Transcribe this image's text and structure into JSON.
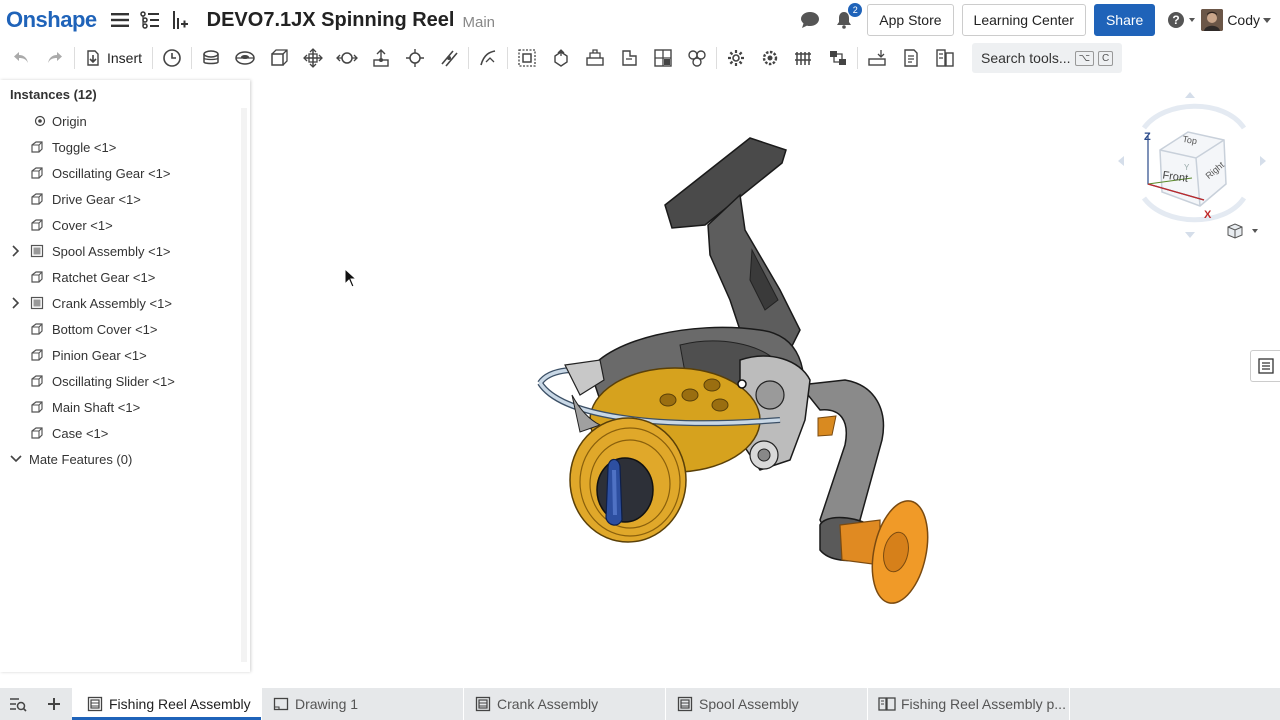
{
  "header": {
    "logo": "Onshape",
    "doc_title": "DEVO7.1JX Spinning Reel",
    "branch": "Main",
    "notification_count": "2",
    "app_store": "App Store",
    "learning_center": "Learning Center",
    "share": "Share",
    "user": "Cody",
    "accent": "#1f63b9"
  },
  "toolbar": {
    "insert": "Insert",
    "search_placeholder": "Search tools...",
    "shortcut_key1": "⌥",
    "shortcut_key2": "C"
  },
  "instances": {
    "title": "Instances (12)",
    "items": [
      {
        "label": "Origin",
        "icon": "origin-icon",
        "expandable": false
      },
      {
        "label": "Toggle <1>",
        "icon": "part-icon",
        "expandable": false
      },
      {
        "label": "Oscillating Gear <1>",
        "icon": "part-icon",
        "expandable": false
      },
      {
        "label": "Drive Gear <1>",
        "icon": "part-icon",
        "expandable": false
      },
      {
        "label": "Cover <1>",
        "icon": "part-icon",
        "expandable": false
      },
      {
        "label": "Spool Assembly <1>",
        "icon": "assembly-icon",
        "expandable": true
      },
      {
        "label": "Ratchet Gear <1>",
        "icon": "part-icon",
        "expandable": false
      },
      {
        "label": "Crank Assembly <1>",
        "icon": "assembly-icon",
        "expandable": true
      },
      {
        "label": "Bottom Cover <1>",
        "icon": "part-icon",
        "expandable": false
      },
      {
        "label": "Pinion Gear <1>",
        "icon": "part-icon",
        "expandable": false
      },
      {
        "label": "Oscillating Slider <1>",
        "icon": "part-icon",
        "expandable": false
      },
      {
        "label": "Main Shaft <1>",
        "icon": "part-icon",
        "expandable": false
      },
      {
        "label": "Case <1>",
        "icon": "part-icon",
        "expandable": false
      }
    ],
    "mate_features": "Mate Features (0)"
  },
  "view_cube": {
    "top": "Top",
    "front": "Front",
    "right": "Right",
    "axis_z": "Z",
    "axis_x": "X",
    "axis_y": "Y"
  },
  "tabs": [
    {
      "label": "Fishing Reel Assembly",
      "icon": "assembly-tab-icon",
      "active": true
    },
    {
      "label": "Drawing 1",
      "icon": "drawing-tab-icon",
      "active": false
    },
    {
      "label": "Crank Assembly",
      "icon": "assembly-tab-icon",
      "active": false
    },
    {
      "label": "Spool Assembly",
      "icon": "assembly-tab-icon",
      "active": false
    },
    {
      "label": "Fishing Reel Assembly p...",
      "icon": "part-studio-tab-icon",
      "active": false
    }
  ]
}
